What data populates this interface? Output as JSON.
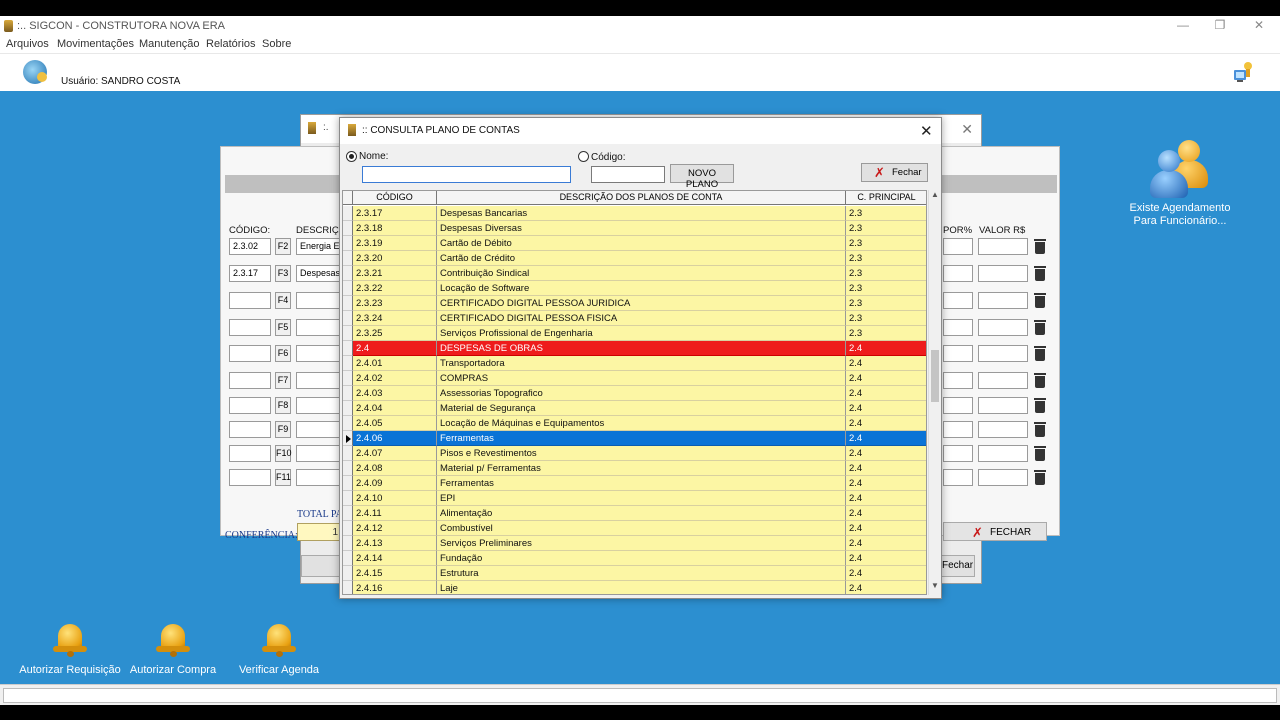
{
  "app": {
    "title": ":.. SIGCON - CONSTRUTORA NOVA ERA",
    "menu": [
      "Arquivos",
      "Movimentações",
      "Manutenção",
      "Relatórios",
      "Sobre"
    ],
    "user_label": "Usuário: SANDRO COSTA",
    "win_minimize": "—",
    "win_restore": "❐",
    "win_close": "✕"
  },
  "background_window": {
    "title": ":.",
    "close": "✕",
    "fechar_label": "Fechar"
  },
  "background_form": {
    "codigo_label": "CÓDIGO:",
    "descricao_label": "DESCRIÇÃ",
    "por_label": "POR%",
    "valor_label": "VALOR R$",
    "rows": [
      {
        "code": "2.3.02",
        "key": "F2",
        "desc": "Energia El"
      },
      {
        "code": "2.3.17",
        "key": "F3",
        "desc": "Despesas"
      },
      {
        "code": "",
        "key": "F4",
        "desc": ""
      },
      {
        "code": "",
        "key": "F5",
        "desc": ""
      },
      {
        "code": "",
        "key": "F6",
        "desc": ""
      },
      {
        "code": "",
        "key": "F7",
        "desc": ""
      },
      {
        "code": "",
        "key": "F8",
        "desc": ""
      },
      {
        "code": "",
        "key": "F9",
        "desc": ""
      },
      {
        "code": "",
        "key": "F10",
        "desc": ""
      },
      {
        "code": "",
        "key": "F11",
        "desc": ""
      }
    ],
    "total_label": "TOTAL PA",
    "conferencia_label": "CONFERÊNCIA:",
    "conferencia_value": "1",
    "fechar_label": "FECHAR"
  },
  "dialog": {
    "title": ":: CONSULTA PLANO DE CONTAS",
    "close": "✕",
    "nome_label": "Nome:",
    "codigo_label": "Código:",
    "nome_value": "",
    "codigo_value": "",
    "novo_plano_label": "NOVO PLANO",
    "fechar_label": "Fechar",
    "columns": [
      "CÓDIGO",
      "DESCRIÇÃO DOS PLANOS DE CONTA",
      "C. PRINCIPAL"
    ],
    "rows": [
      {
        "code": "2.3.17",
        "desc": "Despesas Bancarias",
        "principal": "2.3",
        "state": ""
      },
      {
        "code": "2.3.18",
        "desc": "Despesas Diversas",
        "principal": "2.3",
        "state": ""
      },
      {
        "code": "2.3.19",
        "desc": "Cartão de Débito",
        "principal": "2.3",
        "state": ""
      },
      {
        "code": "2.3.20",
        "desc": "Cartão de Crédito",
        "principal": "2.3",
        "state": ""
      },
      {
        "code": "2.3.21",
        "desc": "Contribuição Sindical",
        "principal": "2.3",
        "state": ""
      },
      {
        "code": "2.3.22",
        "desc": "Locação de Software",
        "principal": "2.3",
        "state": ""
      },
      {
        "code": "2.3.23",
        "desc": "CERTIFICADO DIGITAL PESSOA JURIDICA",
        "principal": "2.3",
        "state": ""
      },
      {
        "code": "2.3.24",
        "desc": "CERTIFICADO DIGITAL PESSOA FISICA",
        "principal": "2.3",
        "state": ""
      },
      {
        "code": "2.3.25",
        "desc": "Serviços Profissional de Engenharia",
        "principal": "2.3",
        "state": ""
      },
      {
        "code": "2.4",
        "desc": "DESPESAS DE OBRAS",
        "principal": "2.4",
        "state": "red"
      },
      {
        "code": "2.4.01",
        "desc": "Transportadora",
        "principal": "2.4",
        "state": ""
      },
      {
        "code": "2.4.02",
        "desc": "COMPRAS",
        "principal": "2.4",
        "state": ""
      },
      {
        "code": "2.4.03",
        "desc": "Assessorias Topografico",
        "principal": "2.4",
        "state": ""
      },
      {
        "code": "2.4.04",
        "desc": "Material de Segurança",
        "principal": "2.4",
        "state": ""
      },
      {
        "code": "2.4.05",
        "desc": "Locação de Máquinas e Equipamentos",
        "principal": "2.4",
        "state": ""
      },
      {
        "code": "2.4.06",
        "desc": "Ferramentas",
        "principal": "2.4",
        "state": "sel"
      },
      {
        "code": "2.4.07",
        "desc": "Pisos e Revestimentos",
        "principal": "2.4",
        "state": ""
      },
      {
        "code": "2.4.08",
        "desc": "Material p/ Ferramentas",
        "principal": "2.4",
        "state": ""
      },
      {
        "code": "2.4.09",
        "desc": "Ferramentas",
        "principal": "2.4",
        "state": ""
      },
      {
        "code": "2.4.10",
        "desc": "EPI",
        "principal": "2.4",
        "state": ""
      },
      {
        "code": "2.4.11",
        "desc": "Alimentação",
        "principal": "2.4",
        "state": ""
      },
      {
        "code": "2.4.12",
        "desc": "Combustível",
        "principal": "2.4",
        "state": ""
      },
      {
        "code": "2.4.13",
        "desc": "Serviços Preliminares",
        "principal": "2.4",
        "state": ""
      },
      {
        "code": "2.4.14",
        "desc": "Fundação",
        "principal": "2.4",
        "state": ""
      },
      {
        "code": "2.4.15",
        "desc": "Estrutura",
        "principal": "2.4",
        "state": ""
      },
      {
        "code": "2.4.16",
        "desc": "Laje",
        "principal": "2.4",
        "state": ""
      }
    ]
  },
  "desktop": {
    "icons": [
      "Autorizar Requisição",
      "Autorizar Compra",
      "Verificar Agenda"
    ],
    "agenda_line1": "Existe Agendamento",
    "agenda_line2": "Para Funcionário..."
  },
  "colors": {
    "desktop": "#2c8fd0",
    "row_yellow": "#fcf6a4",
    "row_red": "#ee1c1c",
    "row_selected": "#0a73d6"
  }
}
